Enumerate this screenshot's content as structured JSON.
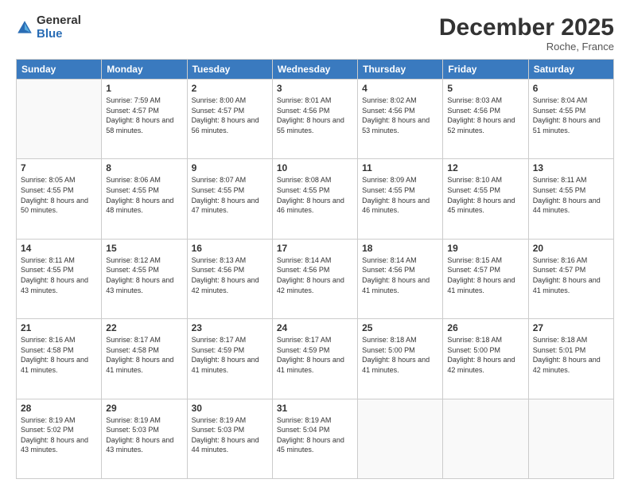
{
  "logo": {
    "general": "General",
    "blue": "Blue"
  },
  "header": {
    "month": "December 2025",
    "location": "Roche, France"
  },
  "weekdays": [
    "Sunday",
    "Monday",
    "Tuesday",
    "Wednesday",
    "Thursday",
    "Friday",
    "Saturday"
  ],
  "weeks": [
    [
      {
        "day": "",
        "sunrise": "",
        "sunset": "",
        "daylight": ""
      },
      {
        "day": "1",
        "sunrise": "Sunrise: 7:59 AM",
        "sunset": "Sunset: 4:57 PM",
        "daylight": "Daylight: 8 hours and 58 minutes."
      },
      {
        "day": "2",
        "sunrise": "Sunrise: 8:00 AM",
        "sunset": "Sunset: 4:57 PM",
        "daylight": "Daylight: 8 hours and 56 minutes."
      },
      {
        "day": "3",
        "sunrise": "Sunrise: 8:01 AM",
        "sunset": "Sunset: 4:56 PM",
        "daylight": "Daylight: 8 hours and 55 minutes."
      },
      {
        "day": "4",
        "sunrise": "Sunrise: 8:02 AM",
        "sunset": "Sunset: 4:56 PM",
        "daylight": "Daylight: 8 hours and 53 minutes."
      },
      {
        "day": "5",
        "sunrise": "Sunrise: 8:03 AM",
        "sunset": "Sunset: 4:56 PM",
        "daylight": "Daylight: 8 hours and 52 minutes."
      },
      {
        "day": "6",
        "sunrise": "Sunrise: 8:04 AM",
        "sunset": "Sunset: 4:55 PM",
        "daylight": "Daylight: 8 hours and 51 minutes."
      }
    ],
    [
      {
        "day": "7",
        "sunrise": "Sunrise: 8:05 AM",
        "sunset": "Sunset: 4:55 PM",
        "daylight": "Daylight: 8 hours and 50 minutes."
      },
      {
        "day": "8",
        "sunrise": "Sunrise: 8:06 AM",
        "sunset": "Sunset: 4:55 PM",
        "daylight": "Daylight: 8 hours and 48 minutes."
      },
      {
        "day": "9",
        "sunrise": "Sunrise: 8:07 AM",
        "sunset": "Sunset: 4:55 PM",
        "daylight": "Daylight: 8 hours and 47 minutes."
      },
      {
        "day": "10",
        "sunrise": "Sunrise: 8:08 AM",
        "sunset": "Sunset: 4:55 PM",
        "daylight": "Daylight: 8 hours and 46 minutes."
      },
      {
        "day": "11",
        "sunrise": "Sunrise: 8:09 AM",
        "sunset": "Sunset: 4:55 PM",
        "daylight": "Daylight: 8 hours and 46 minutes."
      },
      {
        "day": "12",
        "sunrise": "Sunrise: 8:10 AM",
        "sunset": "Sunset: 4:55 PM",
        "daylight": "Daylight: 8 hours and 45 minutes."
      },
      {
        "day": "13",
        "sunrise": "Sunrise: 8:11 AM",
        "sunset": "Sunset: 4:55 PM",
        "daylight": "Daylight: 8 hours and 44 minutes."
      }
    ],
    [
      {
        "day": "14",
        "sunrise": "Sunrise: 8:11 AM",
        "sunset": "Sunset: 4:55 PM",
        "daylight": "Daylight: 8 hours and 43 minutes."
      },
      {
        "day": "15",
        "sunrise": "Sunrise: 8:12 AM",
        "sunset": "Sunset: 4:55 PM",
        "daylight": "Daylight: 8 hours and 43 minutes."
      },
      {
        "day": "16",
        "sunrise": "Sunrise: 8:13 AM",
        "sunset": "Sunset: 4:56 PM",
        "daylight": "Daylight: 8 hours and 42 minutes."
      },
      {
        "day": "17",
        "sunrise": "Sunrise: 8:14 AM",
        "sunset": "Sunset: 4:56 PM",
        "daylight": "Daylight: 8 hours and 42 minutes."
      },
      {
        "day": "18",
        "sunrise": "Sunrise: 8:14 AM",
        "sunset": "Sunset: 4:56 PM",
        "daylight": "Daylight: 8 hours and 41 minutes."
      },
      {
        "day": "19",
        "sunrise": "Sunrise: 8:15 AM",
        "sunset": "Sunset: 4:57 PM",
        "daylight": "Daylight: 8 hours and 41 minutes."
      },
      {
        "day": "20",
        "sunrise": "Sunrise: 8:16 AM",
        "sunset": "Sunset: 4:57 PM",
        "daylight": "Daylight: 8 hours and 41 minutes."
      }
    ],
    [
      {
        "day": "21",
        "sunrise": "Sunrise: 8:16 AM",
        "sunset": "Sunset: 4:58 PM",
        "daylight": "Daylight: 8 hours and 41 minutes."
      },
      {
        "day": "22",
        "sunrise": "Sunrise: 8:17 AM",
        "sunset": "Sunset: 4:58 PM",
        "daylight": "Daylight: 8 hours and 41 minutes."
      },
      {
        "day": "23",
        "sunrise": "Sunrise: 8:17 AM",
        "sunset": "Sunset: 4:59 PM",
        "daylight": "Daylight: 8 hours and 41 minutes."
      },
      {
        "day": "24",
        "sunrise": "Sunrise: 8:17 AM",
        "sunset": "Sunset: 4:59 PM",
        "daylight": "Daylight: 8 hours and 41 minutes."
      },
      {
        "day": "25",
        "sunrise": "Sunrise: 8:18 AM",
        "sunset": "Sunset: 5:00 PM",
        "daylight": "Daylight: 8 hours and 41 minutes."
      },
      {
        "day": "26",
        "sunrise": "Sunrise: 8:18 AM",
        "sunset": "Sunset: 5:00 PM",
        "daylight": "Daylight: 8 hours and 42 minutes."
      },
      {
        "day": "27",
        "sunrise": "Sunrise: 8:18 AM",
        "sunset": "Sunset: 5:01 PM",
        "daylight": "Daylight: 8 hours and 42 minutes."
      }
    ],
    [
      {
        "day": "28",
        "sunrise": "Sunrise: 8:19 AM",
        "sunset": "Sunset: 5:02 PM",
        "daylight": "Daylight: 8 hours and 43 minutes."
      },
      {
        "day": "29",
        "sunrise": "Sunrise: 8:19 AM",
        "sunset": "Sunset: 5:03 PM",
        "daylight": "Daylight: 8 hours and 43 minutes."
      },
      {
        "day": "30",
        "sunrise": "Sunrise: 8:19 AM",
        "sunset": "Sunset: 5:03 PM",
        "daylight": "Daylight: 8 hours and 44 minutes."
      },
      {
        "day": "31",
        "sunrise": "Sunrise: 8:19 AM",
        "sunset": "Sunset: 5:04 PM",
        "daylight": "Daylight: 8 hours and 45 minutes."
      },
      {
        "day": "",
        "sunrise": "",
        "sunset": "",
        "daylight": ""
      },
      {
        "day": "",
        "sunrise": "",
        "sunset": "",
        "daylight": ""
      },
      {
        "day": "",
        "sunrise": "",
        "sunset": "",
        "daylight": ""
      }
    ]
  ]
}
